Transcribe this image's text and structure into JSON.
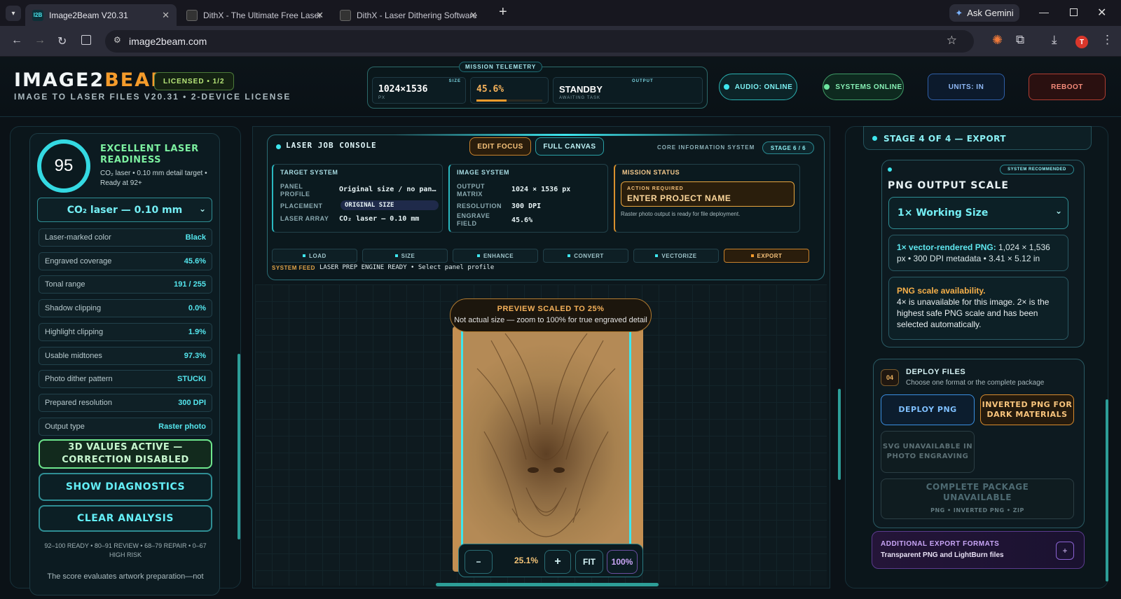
{
  "browser": {
    "tabs": [
      {
        "title": "Image2Beam V20.31",
        "favicon": "I2B"
      },
      {
        "title": "DithX - The Ultimate Free Laser",
        "favicon": ""
      },
      {
        "title": "DithX - Laser Dithering Software",
        "favicon": ""
      }
    ],
    "ask_gemini": "Ask Gemini",
    "url": "image2beam.com",
    "profile_initial": "T"
  },
  "header": {
    "logo_a": "IMAGE2",
    "logo_b": "BEAM",
    "license_badge": "LICENSED • 1/2",
    "subtitle": "IMAGE TO LASER FILES V20.31 • 2-DEVICE LICENSE",
    "telemetry_label": "MISSION TELEMETRY",
    "telemetry": [
      {
        "key": "SIZE",
        "value": "1024×1536",
        "sub": "PX"
      },
      {
        "key": "",
        "value": "45.6%",
        "sub": ""
      },
      {
        "key": "OUTPUT",
        "value": "STANDBY",
        "sub": "AWAITING TASK"
      }
    ],
    "audio": "AUDIO: ONLINE",
    "systems": "SYSTEMS ONLINE",
    "units": "UNITS: IN",
    "reboot": "REBOOT"
  },
  "left": {
    "score": "95",
    "score_title": "EXCELLENT LASER READINESS",
    "score_desc": "CO₂ laser • 0.10 mm detail target • Ready at 92+",
    "laser_select": "CO₂ laser — 0.10 mm",
    "metrics": [
      {
        "label": "Laser-marked color",
        "value": "Black"
      },
      {
        "label": "Engraved coverage",
        "value": "45.6%"
      },
      {
        "label": "Tonal range",
        "value": "191 / 255"
      },
      {
        "label": "Shadow clipping",
        "value": "0.0%"
      },
      {
        "label": "Highlight clipping",
        "value": "1.9%"
      },
      {
        "label": "Usable midtones",
        "value": "97.3%"
      },
      {
        "label": "Photo dither pattern",
        "value": "STUCKI"
      },
      {
        "label": "Prepared resolution",
        "value": "300 DPI"
      },
      {
        "label": "Output type",
        "value": "Raster photo"
      }
    ],
    "btn_3d": "3D VALUES ACTIVE — CORRECTION DISABLED",
    "btn_diag": "SHOW DIAGNOSTICS",
    "btn_clear": "CLEAR ANALYSIS",
    "legend": "92–100 READY • 80–91 REVIEW • 68–79 REPAIR • 0–67 HIGH RISK",
    "footer": "The score evaluates artwork preparation—not"
  },
  "console": {
    "title": "LASER JOB CONSOLE",
    "edit_focus": "EDIT FOCUS",
    "full_canvas": "FULL CANVAS",
    "core": "CORE INFORMATION SYSTEM",
    "stage": "STAGE 6 / 6",
    "target": {
      "title": "TARGET SYSTEM",
      "k1": "PANEL PROFILE",
      "v1": "Original size / no pan…",
      "k2": "PLACEMENT",
      "v2": "ORIGINAL SIZE",
      "k3": "LASER ARRAY",
      "v3": "CO₂ laser — 0.10 mm"
    },
    "image": {
      "title": "IMAGE SYSTEM",
      "k1": "OUTPUT MATRIX",
      "v1": "1024 × 1536 px",
      "k2": "RESOLUTION",
      "v2": "300 DPI",
      "k3": "ENGRAVE FIELD",
      "v3": "45.6%"
    },
    "mission": {
      "title": "MISSION STATUS",
      "action_label": "ACTION REQUIRED",
      "action_value": "ENTER PROJECT NAME",
      "note": "Raster photo output is ready for file deployment."
    },
    "steps": [
      "LOAD",
      "SIZE",
      "ENHANCE",
      "CONVERT",
      "VECTORIZE",
      "EXPORT"
    ],
    "feed_label": "SYSTEM FEED",
    "feed": "LASER PREP ENGINE READY • Select panel profile"
  },
  "preview": {
    "title": "PREVIEW SCALED TO 25%",
    "subtitle": "Not actual size — zoom to 100% for true engraved detail",
    "minus": "−",
    "zoom": "25.1%",
    "plus": "+",
    "fit": "FIT",
    "full": "100%"
  },
  "right": {
    "stage_title": "STAGE 4 OF 4 — EXPORT",
    "recommended": "SYSTEM RECOMMENDED",
    "scale_title": "PNG OUTPUT SCALE",
    "scale_select": "1× Working Size",
    "info_bold": "1× vector-rendered PNG:",
    "info_rest": " 1,024 × 1,536 px • 300 DPI metadata • 3.41 × 5.12 in",
    "warn_title": "PNG scale availability.",
    "warn_body": "4× is unavailable for this image. 2× is the highest safe PNG scale and has been selected automatically.",
    "deploy_num": "04",
    "deploy_title": "DEPLOY FILES",
    "deploy_sub": "Choose one format or the complete package",
    "btn_png": "DEPLOY PNG",
    "btn_inverted": "INVERTED PNG FOR DARK MATERIALS",
    "btn_svg": "SVG UNAVAILABLE IN PHOTO ENGRAVING",
    "pkg_title": "COMPLETE PACKAGE UNAVAILABLE",
    "pkg_sub": "PNG • INVERTED PNG • ZIP",
    "additional_title": "ADDITIONAL EXPORT FORMATS",
    "additional_sub": "Transparent PNG and LightBurn files",
    "additional_btn": "+"
  },
  "colors": {
    "accent": "#3ee6ee",
    "orange": "#f59b2b",
    "red": "#e25a4a",
    "purple": "#a56be8"
  }
}
